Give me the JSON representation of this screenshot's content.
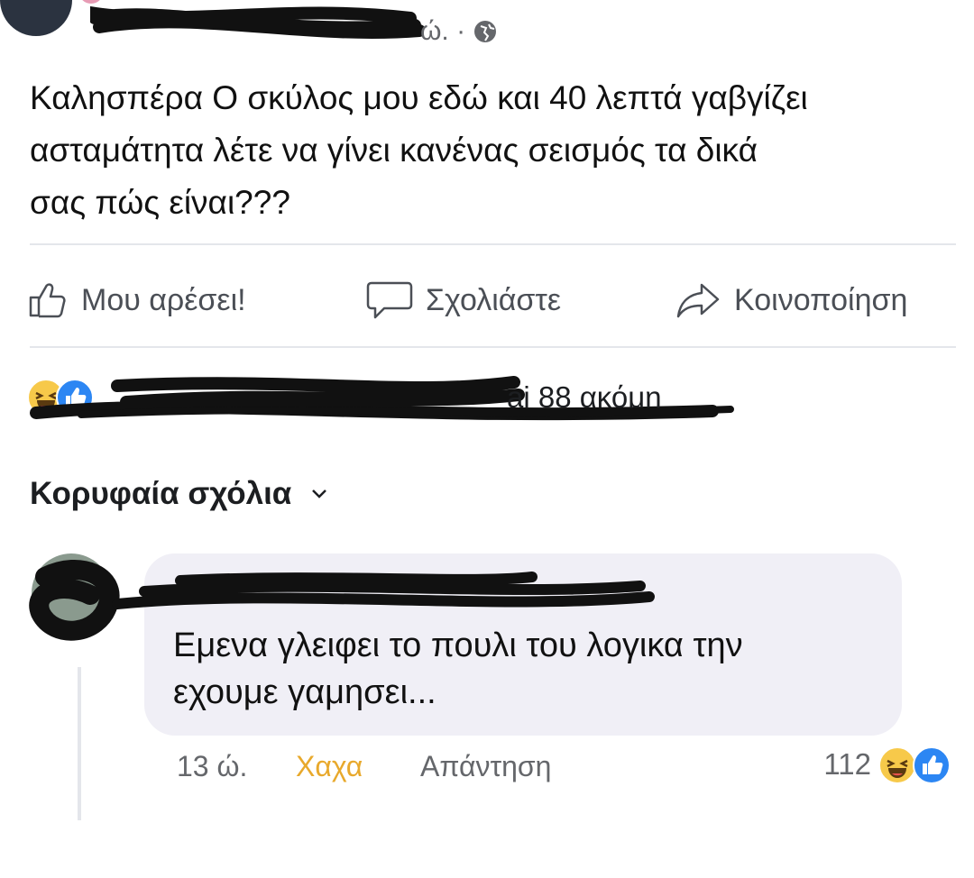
{
  "post": {
    "time_suffix": "ώ. ·",
    "globe_icon": "globe-icon",
    "text_lines": [
      "Καλησπέρα Ο σκύλος μου εδώ και 40 λεπτά γαβγίζει",
      "ασταμάτητα λέτε να γίνει κανένας σεισμός τα δικά",
      "σας πώς είναι???"
    ]
  },
  "actions": {
    "like": "Μου αρέσει!",
    "comment": "Σχολιάστε",
    "share": "Κοινοποίηση"
  },
  "reactions": {
    "count_text": "ai 88 ακόμη",
    "icons": [
      "haha-icon",
      "like-icon"
    ]
  },
  "top_comments": {
    "label": "Κορυφαία σχόλια"
  },
  "comment": {
    "text_lines": [
      "Εμενα γλειφει το πουλι του λογικα την",
      "εχουμε γαμησει..."
    ],
    "time": "13 ώ.",
    "reaction_label": "Χαχα",
    "reply_label": "Απάντηση",
    "reaction_count": "112"
  },
  "colors": {
    "haha_accent": "#e8a92c",
    "like_blue": "#2c86f3",
    "bubble_bg": "#f0eff6"
  }
}
